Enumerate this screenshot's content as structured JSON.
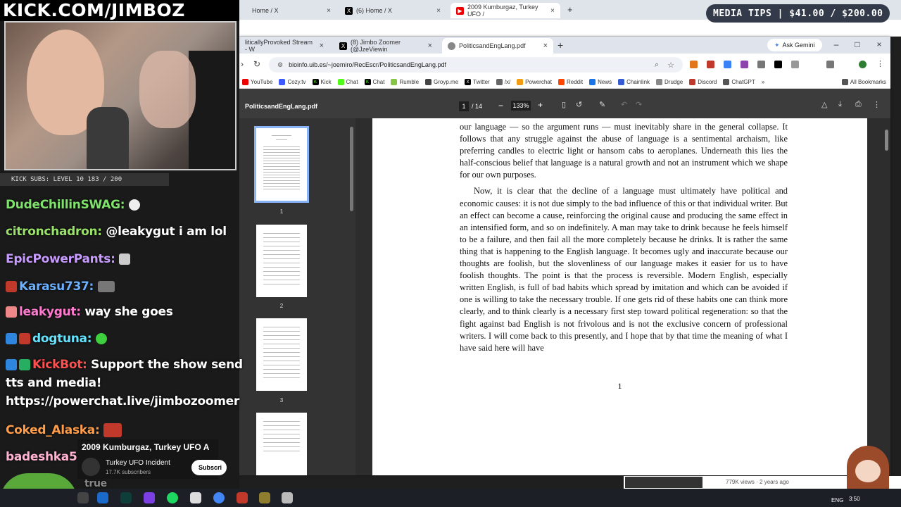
{
  "overlay": {
    "banner": "KICK.COM/JIMBOZ",
    "subs_bar": "KICK SUBS: LEVEL 10 183 / 200",
    "chat": [
      {
        "user": "DudeChillinSWAG:",
        "text": "",
        "color": "#7fe26b",
        "badge": ""
      },
      {
        "user": "citronchadron:",
        "text": "@leakygut i am lol",
        "color": "#9be26b",
        "badge": ""
      },
      {
        "user": "EpicPowerPants:",
        "text": "",
        "color": "#c89bff",
        "badge": ""
      },
      {
        "user": "Karasu737:",
        "text": "",
        "color": "#6bb0ff",
        "badge": "#c0392b"
      },
      {
        "user": "leakygut:",
        "text": "way she goes",
        "color": "#ff7bd0",
        "badge": "#e88"
      },
      {
        "user": "dogtuna:",
        "text": "",
        "color": "#64e3ff",
        "badge": "#2e86de"
      },
      {
        "user": "KickBot:",
        "text": "Support the show send tts and media! https://powerchat.live/jimbozoomer",
        "color": "#ff5050",
        "badge": "#27ae60"
      },
      {
        "user": "Coked_Alaska:",
        "text": "",
        "color": "#ff9d4a",
        "badge": ""
      },
      {
        "user": "badeshka5:",
        "text": "",
        "color": "#ffb3d1",
        "badge": ""
      }
    ],
    "last_msg_fragment": "true"
  },
  "media_tips": "MEDIA TIPS | $41.00 / $200.00",
  "back_browser": {
    "tabs": [
      {
        "label": "Home / X"
      },
      {
        "label": "(6) Home / X"
      },
      {
        "label": "2009 Kumburgaz, Turkey UFO /"
      }
    ]
  },
  "browser": {
    "tabs": [
      {
        "label": "liticallyProvoked Stream - W"
      },
      {
        "label": "(8) Jimbo Zoomer (@JzeViewin"
      },
      {
        "label": "PoliticsandEngLang.pdf"
      }
    ],
    "ask_gemini": "Ask Gemini",
    "url": "bioinfo.uib.es/~joemiro/RecEscr/PoliticsandEngLang.pdf",
    "bookmarks": [
      "YouTube",
      "Cozy.tv",
      "Kick",
      "Chat",
      "Chat",
      "Rumble",
      "Groyp.me",
      "Twitter",
      "/x/",
      "Powerchat",
      "Reddit",
      "News",
      "Chainlink",
      "Drudge",
      "Discord",
      "ChatGPT"
    ],
    "all_bookmarks": "All Bookmarks",
    "colors": {
      "accent": "#1a73e8",
      "tabstrip": "#dee3ec"
    }
  },
  "pdf": {
    "title": "PoliticsandEngLang.pdf",
    "page": "1",
    "total": "/ 14",
    "zoom": "133%",
    "thumbnails": [
      "1",
      "2",
      "3"
    ],
    "para1": "our language — so the argument runs — must inevitably share in the general collapse. It follows that any struggle against the abuse of language is a sentimental archaism, like preferring candles to electric light or hansom cabs to aeroplanes. Underneath this lies the half-conscious belief that language is a natural growth and not an instrument which we shape for our own purposes.",
    "para2": "Now, it is clear that the decline of a language must ultimately have political and economic causes: it is not due simply to the bad influence of this or that individual writer. But an effect can become a cause, reinforcing the original cause and producing the same effect in an intensified form, and so on indefinitely. A man may take to drink because he feels himself to be a failure, and then fail all the more completely because he drinks. It is rather the same thing that is happening to the English language. It becomes ugly and inaccurate because our thoughts are foolish, but the slovenliness of our language makes it easier for us to have foolish thoughts. The point is that the process is reversible. Modern English, especially written English, is full of bad habits which spread by imitation and which can be avoided if one is willing to take the necessary trouble. If one gets rid of these habits one can think more clearly, and to think clearly is a necessary first step toward political regeneration: so that the fight against bad English is not frivolous and is not the exclusive concern of professional writers. I will come back to this presently, and I hope that by that time the meaning of what I have said here will have",
    "page_number": "1"
  },
  "youtube": {
    "title": "2009 Kumburgaz, Turkey UFO A",
    "channel": "Turkey UFO Incident",
    "subs": "17.7K subscribers",
    "subscribe": "Subscri",
    "meta": "779K views · 2 years ago"
  },
  "taskbar": {
    "lang": "ENG",
    "clock": "3:50"
  }
}
